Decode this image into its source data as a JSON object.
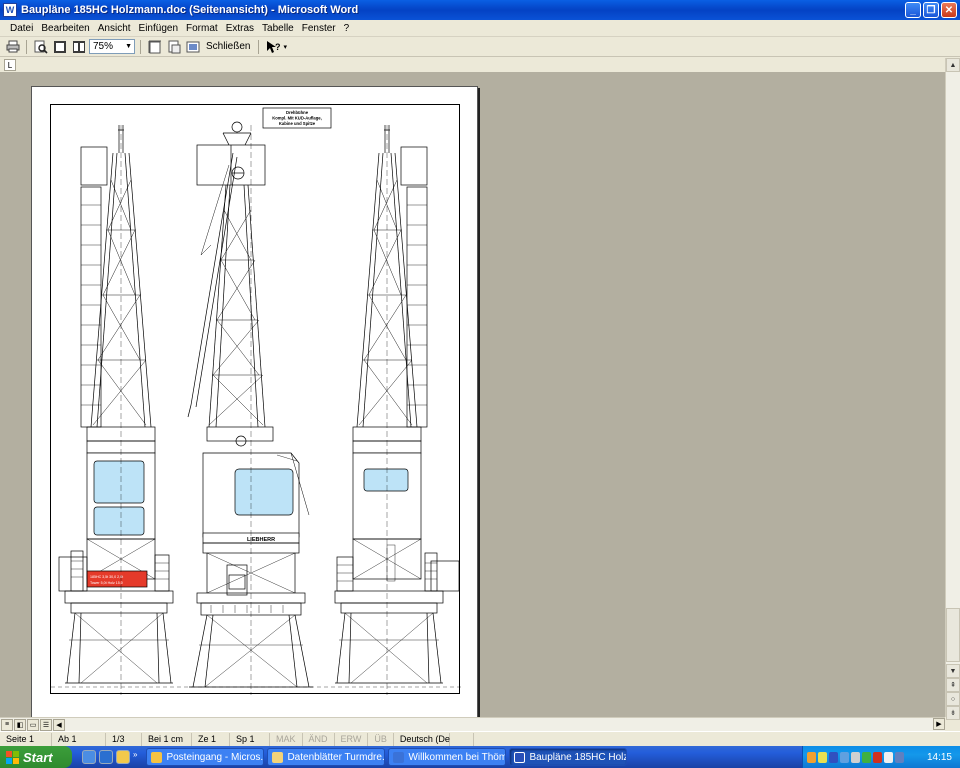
{
  "window": {
    "title": "Baupläne 185HC Holzmann.doc (Seitenansicht) - Microsoft Word",
    "app_icon": "W",
    "buttons": {
      "minimize": "_",
      "maximize": "❐",
      "close": "✕"
    }
  },
  "menu": [
    "Datei",
    "Bearbeiten",
    "Ansicht",
    "Einfügen",
    "Format",
    "Extras",
    "Tabelle",
    "Fenster",
    "?"
  ],
  "toolbar": {
    "zoom": "75%",
    "close_label": "Schließen",
    "help_label": "?"
  },
  "ruler": {
    "tab_marker": "L"
  },
  "document": {
    "drawing": {
      "label_lines": [
        "Drehbühne",
        "Kompl. Mit KUD-Auflage,",
        "Kabine und Spitze"
      ],
      "brand_text": "LIEBHERR",
      "red_plate_lines": [
        "185HC  3,5t  30,0  2,0t",
        "Tower  5,0t  Holz  15,0"
      ]
    }
  },
  "statusbar": {
    "page": "Seite 1",
    "section": "Ab 1",
    "page_of": "1/3",
    "position": "Bei 1 cm",
    "line": "Ze 1",
    "column": "Sp 1",
    "mak": "MAK",
    "and": "ÄND",
    "erw": "ERW",
    "ub": "ÜB",
    "language": "Deutsch (De"
  },
  "taskbar": {
    "start_label": "Start",
    "tasks": [
      {
        "label": "Posteingang - Micros...",
        "active": false,
        "icon_color": "#f5c242"
      },
      {
        "label": "Datenblätter Turmdre...",
        "active": false,
        "icon_color": "#f3d37a"
      },
      {
        "label": "Willkommen bei Thöm...",
        "active": false,
        "icon_color": "#3a72d8"
      },
      {
        "label": "Baupläne 185HC Holz...",
        "active": true,
        "icon_color": "#2850b8"
      }
    ],
    "clock": "14:15",
    "colors": {
      "taskbar": "#245edb",
      "start": "#3c9e3b",
      "tray": "#0f8be6"
    }
  }
}
